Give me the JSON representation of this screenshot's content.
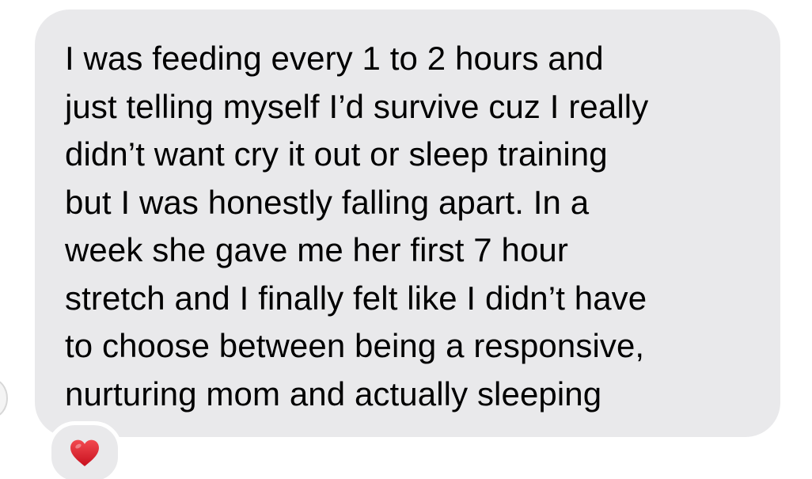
{
  "message": {
    "lines": [
      "I was feeding every 1 to 2 hours and",
      "just telling myself I’d survive cuz I really",
      "didn’t want cry it out or sleep training",
      "but I was honestly falling apart. In a",
      "week she gave me her first 7 hour",
      "stretch and I finally felt like I didn’t have",
      "to choose between being a responsive,",
      "nurturing mom and actually sleeping"
    ]
  },
  "reaction": {
    "icon": "heart-icon",
    "color": "#e0202d"
  },
  "colors": {
    "bubble": "#e9e9eb",
    "text": "#000000",
    "background": "#ffffff"
  }
}
